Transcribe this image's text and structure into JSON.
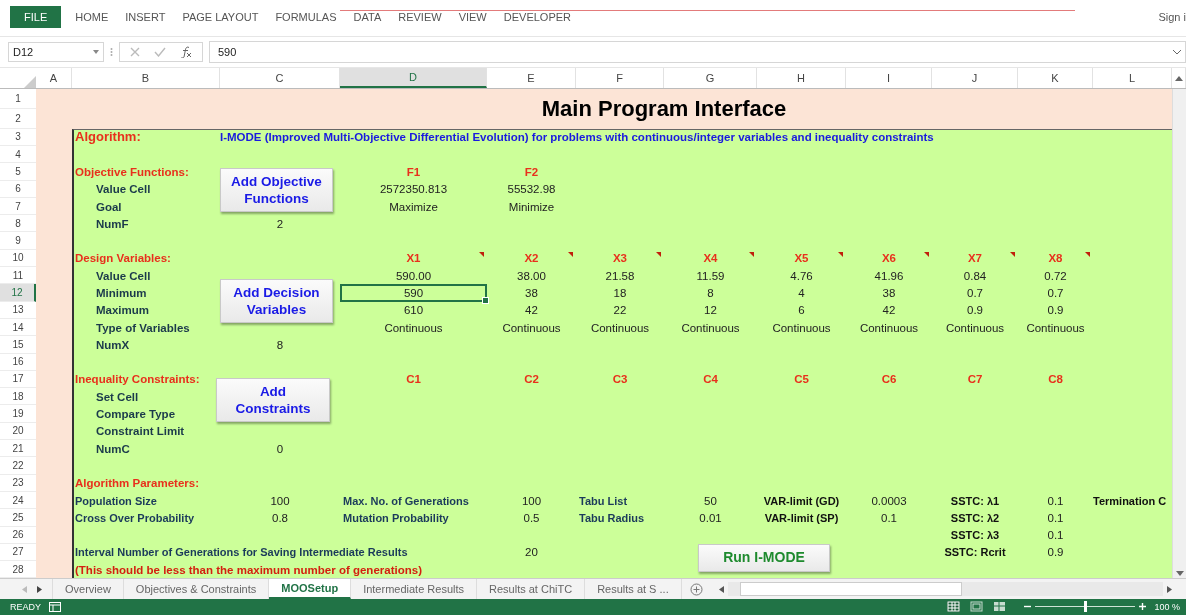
{
  "ribbon": {
    "tabs": [
      {
        "label": "FILE",
        "kind": "file"
      },
      {
        "label": "HOME",
        "kind": "tab"
      },
      {
        "label": "INSERT",
        "kind": "tab"
      },
      {
        "label": "PAGE LAYOUT",
        "kind": "tab"
      },
      {
        "label": "FORMULAS",
        "kind": "tab"
      },
      {
        "label": "DATA",
        "kind": "tab"
      },
      {
        "label": "REVIEW",
        "kind": "tab"
      },
      {
        "label": "VIEW",
        "kind": "tab"
      },
      {
        "label": "DEVELOPER",
        "kind": "tab"
      }
    ],
    "sign_in": "Sign i"
  },
  "formula_bar": {
    "name_box": "D12",
    "formula": "590"
  },
  "column_headers": [
    {
      "label": "A",
      "selected": false
    },
    {
      "label": "B",
      "selected": false
    },
    {
      "label": "C",
      "selected": false
    },
    {
      "label": "D",
      "selected": true
    },
    {
      "label": "E",
      "selected": false
    },
    {
      "label": "F",
      "selected": false
    },
    {
      "label": "G",
      "selected": false
    },
    {
      "label": "H",
      "selected": false
    },
    {
      "label": "I",
      "selected": false
    },
    {
      "label": "J",
      "selected": false
    },
    {
      "label": "K",
      "selected": false
    },
    {
      "label": "L",
      "selected": false
    }
  ],
  "title": "Main Program Interface",
  "rows": [
    {
      "number": "1",
      "selected": false
    },
    {
      "number": "2",
      "selected": false
    },
    {
      "number": "3",
      "selected": false,
      "cells": {
        "b": {
          "text": "Algorithm:",
          "kind": "heading"
        },
        "c": {
          "text": "I-MODE (Improved Multi-Objective Differential Evolution) for problems with continuous/integer variables and inequality constraints",
          "kind": "description"
        }
      }
    },
    {
      "number": "4",
      "selected": false
    },
    {
      "number": "5",
      "selected": false,
      "cells": {
        "b": {
          "text": "Objective Functions:",
          "kind": "section"
        },
        "d": {
          "text": "F1",
          "kind": "header"
        },
        "e": {
          "text": "F2",
          "kind": "header"
        }
      }
    },
    {
      "number": "6",
      "selected": false,
      "cells": {
        "b": {
          "text": "Value Cell",
          "kind": "label"
        },
        "d": {
          "text": "2572350.813",
          "kind": "value"
        },
        "e": {
          "text": "55532.98",
          "kind": "value"
        }
      }
    },
    {
      "number": "7",
      "selected": false,
      "cells": {
        "b": {
          "text": "Goal",
          "kind": "label"
        },
        "d": {
          "text": "Maximize",
          "kind": "value"
        },
        "e": {
          "text": "Minimize",
          "kind": "value"
        }
      }
    },
    {
      "number": "8",
      "selected": false,
      "cells": {
        "b": {
          "text": "NumF",
          "kind": "label"
        },
        "c": {
          "text": "2",
          "kind": "value"
        }
      }
    },
    {
      "number": "9",
      "selected": false
    },
    {
      "number": "10",
      "selected": false,
      "cells": {
        "b": {
          "text": "Design Variables:",
          "kind": "section"
        },
        "d": {
          "text": "X1",
          "kind": "header",
          "has_comment": true
        },
        "e": {
          "text": "X2",
          "kind": "header",
          "has_comment": true
        },
        "f": {
          "text": "X3",
          "kind": "header",
          "has_comment": true
        },
        "g": {
          "text": "X4",
          "kind": "header",
          "has_comment": true
        },
        "h": {
          "text": "X5",
          "kind": "header",
          "has_comment": true
        },
        "i": {
          "text": "X6",
          "kind": "header",
          "has_comment": true
        },
        "j": {
          "text": "X7",
          "kind": "header",
          "has_comment": true
        },
        "k": {
          "text": "X8",
          "kind": "header",
          "has_comment": true
        }
      }
    },
    {
      "number": "11",
      "selected": false,
      "cells": {
        "b": {
          "text": "Value Cell",
          "kind": "label"
        },
        "d": {
          "text": "590.00",
          "kind": "value"
        },
        "e": {
          "text": "38.00",
          "kind": "value"
        },
        "f": {
          "text": "21.58",
          "kind": "value"
        },
        "g": {
          "text": "11.59",
          "kind": "value"
        },
        "h": {
          "text": "4.76",
          "kind": "value"
        },
        "i": {
          "text": "41.96",
          "kind": "value"
        },
        "j": {
          "text": "0.84",
          "kind": "value"
        },
        "k": {
          "text": "0.72",
          "kind": "value"
        }
      }
    },
    {
      "number": "12",
      "selected": true,
      "cells": {
        "b": {
          "text": "Minimum",
          "kind": "label"
        },
        "d": {
          "text": "590",
          "kind": "value"
        },
        "e": {
          "text": "38",
          "kind": "value"
        },
        "f": {
          "text": "18",
          "kind": "value"
        },
        "g": {
          "text": "8",
          "kind": "value"
        },
        "h": {
          "text": "4",
          "kind": "value"
        },
        "i": {
          "text": "38",
          "kind": "value"
        },
        "j": {
          "text": "0.7",
          "kind": "value"
        },
        "k": {
          "text": "0.7",
          "kind": "value"
        }
      }
    },
    {
      "number": "13",
      "selected": false,
      "cells": {
        "b": {
          "text": "Maximum",
          "kind": "label"
        },
        "d": {
          "text": "610",
          "kind": "value"
        },
        "e": {
          "text": "42",
          "kind": "value"
        },
        "f": {
          "text": "22",
          "kind": "value"
        },
        "g": {
          "text": "12",
          "kind": "value"
        },
        "h": {
          "text": "6",
          "kind": "value"
        },
        "i": {
          "text": "42",
          "kind": "value"
        },
        "j": {
          "text": "0.9",
          "kind": "value"
        },
        "k": {
          "text": "0.9",
          "kind": "value"
        }
      }
    },
    {
      "number": "14",
      "selected": false,
      "cells": {
        "b": {
          "text": "Type of Variables",
          "kind": "label"
        },
        "d": {
          "text": "Continuous",
          "kind": "value"
        },
        "e": {
          "text": "Continuous",
          "kind": "value"
        },
        "f": {
          "text": "Continuous",
          "kind": "value"
        },
        "g": {
          "text": "Continuous",
          "kind": "value"
        },
        "h": {
          "text": "Continuous",
          "kind": "value"
        },
        "i": {
          "text": "Continuous",
          "kind": "value"
        },
        "j": {
          "text": "Continuous",
          "kind": "value"
        },
        "k": {
          "text": "Continuous",
          "kind": "value"
        }
      }
    },
    {
      "number": "15",
      "selected": false,
      "cells": {
        "b": {
          "text": "NumX",
          "kind": "label"
        },
        "c": {
          "text": "8",
          "kind": "value"
        }
      }
    },
    {
      "number": "16",
      "selected": false
    },
    {
      "number": "17",
      "selected": false,
      "cells": {
        "b": {
          "text": "Inequality Constraints:",
          "kind": "section"
        },
        "d": {
          "text": "C1",
          "kind": "header"
        },
        "e": {
          "text": "C2",
          "kind": "header"
        },
        "f": {
          "text": "C3",
          "kind": "header"
        },
        "g": {
          "text": "C4",
          "kind": "header"
        },
        "h": {
          "text": "C5",
          "kind": "header"
        },
        "i": {
          "text": "C6",
          "kind": "header"
        },
        "j": {
          "text": "C7",
          "kind": "header"
        },
        "k": {
          "text": "C8",
          "kind": "header"
        }
      }
    },
    {
      "number": "18",
      "selected": false,
      "cells": {
        "b": {
          "text": "Set Cell",
          "kind": "label"
        }
      }
    },
    {
      "number": "19",
      "selected": false,
      "cells": {
        "b": {
          "text": "Compare Type",
          "kind": "label"
        }
      }
    },
    {
      "number": "20",
      "selected": false,
      "cells": {
        "b": {
          "text": "Constraint Limit",
          "kind": "label"
        }
      }
    },
    {
      "number": "21",
      "selected": false,
      "cells": {
        "b": {
          "text": "NumC",
          "kind": "label"
        },
        "c": {
          "text": "0",
          "kind": "value"
        }
      }
    },
    {
      "number": "22",
      "selected": false
    },
    {
      "number": "23",
      "selected": false,
      "cells": {
        "b": {
          "text": "Algorithm Parameters:",
          "kind": "section"
        }
      }
    },
    {
      "number": "24",
      "selected": false,
      "cells": {
        "b": {
          "text": "Population Size",
          "kind": "param"
        },
        "c": {
          "text": "100",
          "kind": "value"
        },
        "d": {
          "text": "Max. No. of Generations",
          "kind": "param"
        },
        "e": {
          "text": "100",
          "kind": "value"
        },
        "f": {
          "text": "Tabu List",
          "kind": "param"
        },
        "g": {
          "text": "50",
          "kind": "value"
        },
        "h": {
          "text": "VAR-limit (GD)",
          "kind": "param-center"
        },
        "i": {
          "text": "0.0003",
          "kind": "value"
        },
        "j": {
          "text": "SSTC: λ1",
          "kind": "param-center"
        },
        "k": {
          "text": "0.1",
          "kind": "value"
        },
        "l": {
          "text": "Termination C",
          "kind": "param-dark"
        }
      }
    },
    {
      "number": "25",
      "selected": false,
      "cells": {
        "b": {
          "text": "Cross Over Probability",
          "kind": "param"
        },
        "c": {
          "text": "0.8",
          "kind": "value"
        },
        "d": {
          "text": "Mutation Probability",
          "kind": "param"
        },
        "e": {
          "text": "0.5",
          "kind": "value"
        },
        "f": {
          "text": "Tabu Radius",
          "kind": "param"
        },
        "g": {
          "text": "0.01",
          "kind": "value"
        },
        "h": {
          "text": "VAR-limit (SP)",
          "kind": "param-center"
        },
        "i": {
          "text": "0.1",
          "kind": "value"
        },
        "j": {
          "text": "SSTC: λ2",
          "kind": "param-center"
        },
        "k": {
          "text": "0.1",
          "kind": "value"
        }
      }
    },
    {
      "number": "26",
      "selected": false,
      "cells": {
        "j": {
          "text": "SSTC: λ3",
          "kind": "param-center"
        },
        "k": {
          "text": "0.1",
          "kind": "value"
        }
      }
    },
    {
      "number": "27",
      "selected": false,
      "cells": {
        "b": {
          "text": "Interval Number of Generations for Saving Intermediate Results",
          "kind": "param"
        },
        "e": {
          "text": "20",
          "kind": "value"
        },
        "j": {
          "text": "SSTC: Rcrit",
          "kind": "param-center"
        },
        "k": {
          "text": "0.9",
          "kind": "value"
        }
      }
    },
    {
      "number": "28",
      "selected": false,
      "cells": {
        "b": {
          "text": "(This should be less than the maximum number of generations)",
          "kind": "note"
        }
      }
    }
  ],
  "buttons": [
    {
      "label": "Add Objective Functions",
      "kind": "add"
    },
    {
      "label": "Add Decision Variables",
      "kind": "add"
    },
    {
      "label": "Add Constraints",
      "kind": "add"
    },
    {
      "label": "Run I-MODE",
      "kind": "run"
    }
  ],
  "sheet_tabs": [
    {
      "label": "Overview",
      "selected": false
    },
    {
      "label": "Objectives & Constraints",
      "selected": false
    },
    {
      "label": "MOOSetup",
      "selected": true
    },
    {
      "label": "Intermediate Results",
      "selected": false
    },
    {
      "label": "Results at ChiTC",
      "selected": false
    },
    {
      "label": "Results at S ...",
      "selected": false
    }
  ],
  "status_bar": {
    "status": "READY",
    "views": [
      {
        "kind": "normal",
        "selected": true
      },
      {
        "kind": "page-layout",
        "selected": false
      },
      {
        "kind": "page-break",
        "selected": false
      }
    ],
    "zoom_slider": {
      "level": 0.5
    },
    "zoom": "100 %"
  }
}
